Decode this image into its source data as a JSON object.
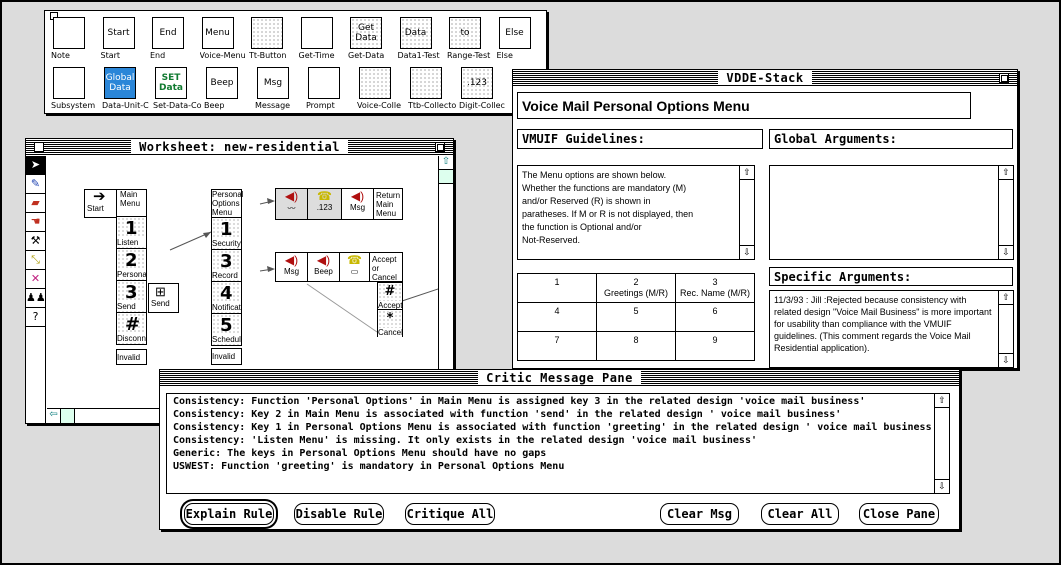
{
  "palette": {
    "tools": [
      {
        "icon": "note",
        "box": "",
        "label": "Note"
      },
      {
        "icon": "start",
        "box": "Start",
        "label": "Start"
      },
      {
        "icon": "end",
        "box": "End",
        "label": "End"
      },
      {
        "icon": "voice-menu",
        "box": "Menu",
        "label": "Voice-Menu"
      },
      {
        "icon": "tt-button",
        "box": "",
        "label": "Tt-Button"
      },
      {
        "icon": "get-time",
        "box": "",
        "label": "Get-Time"
      },
      {
        "icon": "get-data",
        "box": "Get Data",
        "label": "Get-Data"
      },
      {
        "icon": "data1-test",
        "box": "Data",
        "label": "Data1-Test"
      },
      {
        "icon": "range-test",
        "box": "to",
        "label": "Range-Test"
      },
      {
        "icon": "else",
        "box": "Else",
        "label": "Else"
      },
      {
        "icon": "subsystem",
        "box": "",
        "label": "Subsystem"
      },
      {
        "icon": "global-data",
        "box": "Global Data",
        "label": "Data-Unit-C"
      },
      {
        "icon": "set-data",
        "box": "SET Data",
        "label": "Set-Data-Co"
      },
      {
        "icon": "beep",
        "box": "Beep",
        "label": "Beep"
      },
      {
        "icon": "message",
        "box": "Msg",
        "label": "Message"
      },
      {
        "icon": "prompt",
        "box": "",
        "label": "Prompt"
      },
      {
        "icon": "voice-collect",
        "box": "",
        "label": "Voice-Colle"
      },
      {
        "icon": "ttb-collect",
        "box": "",
        "label": "Ttb-Collecto"
      },
      {
        "icon": "digit-collect",
        "box": ".123",
        "label": "Digit-Collec"
      }
    ]
  },
  "vdde": {
    "title": "VDDE-Stack",
    "heading": "Voice Mail Personal Options Menu",
    "guidelines_label": "VMUIF Guidelines:",
    "guidelines_text": "The Menu options are shown below.\nWhether the functions are mandatory (M)\nand/or Reserved (R) is shown in\nparatheses.  If M or R is not displayed, then\nthe function is Optional and/or\nNot-Reserved.",
    "global_label": "Global Arguments:",
    "specific_label": "Specific Arguments:",
    "specific_text": "11/3/93 : Jill :Rejected because consistency with related design \"Voice Mail Business\" is more important for usability than compliance with the VMUIF guidelines. (This comment regards the Voice Mail Residential application).",
    "grid": [
      [
        {
          "k": "1",
          "v": ""
        },
        {
          "k": "2",
          "v": "Greetings (M/R)"
        },
        {
          "k": "3",
          "v": "Rec. Name (M/R)"
        }
      ],
      [
        {
          "k": "4",
          "v": ""
        },
        {
          "k": "5",
          "v": ""
        },
        {
          "k": "6",
          "v": ""
        }
      ],
      [
        {
          "k": "7",
          "v": ""
        },
        {
          "k": "8",
          "v": ""
        },
        {
          "k": "9",
          "v": ""
        }
      ]
    ]
  },
  "worksheet": {
    "title": "Worksheet: new-residential",
    "tool_icons": [
      "arrow-pointer-icon",
      "pencil-icon",
      "eraser-icon",
      "hand-icon",
      "hammer-icon",
      "connector-icon",
      "delete-link-icon",
      "group-icon",
      "help-icon"
    ],
    "start_label": "Start",
    "main_menu_label": "Main Menu",
    "personal_menu_label": "Personal Options Menu",
    "main_keys": [
      {
        "k": "1",
        "label": "Listen"
      },
      {
        "k": "2",
        "label": "Personal"
      },
      {
        "k": "3",
        "label": "Send"
      },
      {
        "k": "#",
        "label": "Disconn"
      }
    ],
    "personal_keys": [
      {
        "k": "1",
        "label": "Security"
      },
      {
        "k": "3",
        "label": "Record"
      },
      {
        "k": "4",
        "label": "Notificat"
      },
      {
        "k": "5",
        "label": "Schedule"
      }
    ],
    "invalid_label": "Invalid",
    "send_label": "Send",
    "collect_value": ".123",
    "msg_label": "Msg",
    "beep_label": "Beep",
    "return_label": "Return Main Menu",
    "accept_cancel_label": "Accept or Cancel",
    "accept_label": "Accept",
    "cancel_label": "Cancel",
    "accept_key": "#",
    "cancel_key": "*"
  },
  "critic": {
    "title": "Critic Message Pane",
    "messages": [
      "Consistency: Function 'Personal Options' in Main Menu is assigned key 3 in the related design 'voice mail business'",
      "Consistency: Key 2 in  Main Menu is associated with function  'send' in the related design ' voice mail business'",
      "Consistency: Key 1 in  Personal Options Menu is associated with function  'greeting' in the related design ' voice mail business'",
      "Consistency: 'Listen Menu' is missing. It only exists in the related design 'voice mail business'",
      "Generic: The keys in Personal Options Menu should have no gaps",
      "USWEST: Function 'greeting' is mandatory in Personal Options Menu"
    ],
    "buttons": {
      "explain": "Explain Rule",
      "disable": "Disable Rule",
      "critique": "Critique All",
      "clear_msg": "Clear Msg",
      "clear_all": "Clear All",
      "close": "Close Pane"
    }
  }
}
